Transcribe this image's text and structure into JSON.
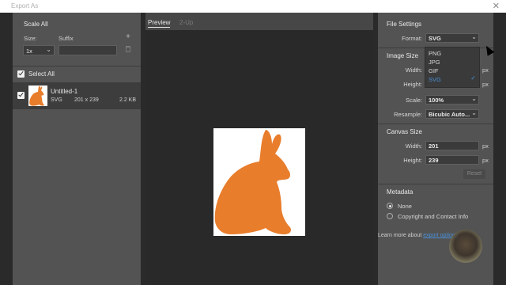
{
  "window": {
    "title": "Export As",
    "close_glyph": "✕"
  },
  "left_panel": {
    "scale_all": "Scale All",
    "size_label": "Size:",
    "suffix_label": "Suffix",
    "add_glyph": "+",
    "scale_value": "1x",
    "suffix_value": "",
    "select_all": "Select All",
    "asset": {
      "name": "Untitled-1",
      "type": "SVG",
      "dimensions": "201 x 239",
      "size": "2.2 KB"
    }
  },
  "tabs": {
    "preview": "Preview",
    "two_up": "2-Up"
  },
  "file_settings": {
    "header": "File Settings",
    "format_label": "Format:",
    "format_value": "SVG",
    "format_options": [
      "PNG",
      "JPG",
      "GIF",
      "SVG"
    ],
    "selected_option": "SVG"
  },
  "image_size": {
    "header": "Image Size",
    "width_label": "Width:",
    "height_label": "Height:",
    "unit": "px",
    "scale_label": "Scale:",
    "scale_value": "100%",
    "resample_label": "Resample:",
    "resample_value": "Bicubic Auto..."
  },
  "canvas_size": {
    "header": "Canvas Size",
    "width_label": "Width:",
    "width_value": "201",
    "height_label": "Height:",
    "height_value": "239",
    "unit": "px",
    "reset_label": "Reset"
  },
  "metadata": {
    "header": "Metadata",
    "options": [
      "None",
      "Copyright and Contact Info"
    ],
    "selected": "None"
  },
  "footer": {
    "learn_text": "Learn more about",
    "link_text": "export options"
  },
  "colors": {
    "accent": "#4a90d9",
    "rabbit": "#e87d2b"
  }
}
